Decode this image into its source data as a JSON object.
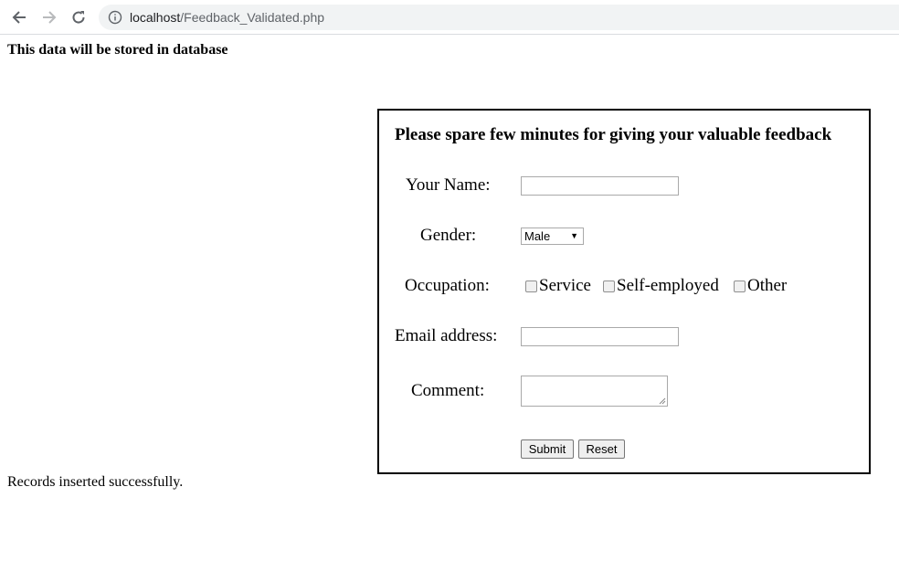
{
  "browser": {
    "url_host": "localhost",
    "url_path": "/Feedback_Validated.php"
  },
  "page": {
    "notice": "This data will be stored in database",
    "records_message": "Records inserted successfully."
  },
  "form": {
    "title": "Please spare few minutes for giving your valuable feedback",
    "name_label": "Your Name:",
    "name_value": "",
    "gender_label": "Gender:",
    "gender_selected": "Male",
    "occupation_label": "Occupation:",
    "occupation_options": [
      "Service",
      "Self-employed",
      "Other"
    ],
    "email_label": "Email address:",
    "email_value": "",
    "comment_label": "Comment:",
    "comment_value": "",
    "submit_label": "Submit",
    "reset_label": "Reset"
  }
}
